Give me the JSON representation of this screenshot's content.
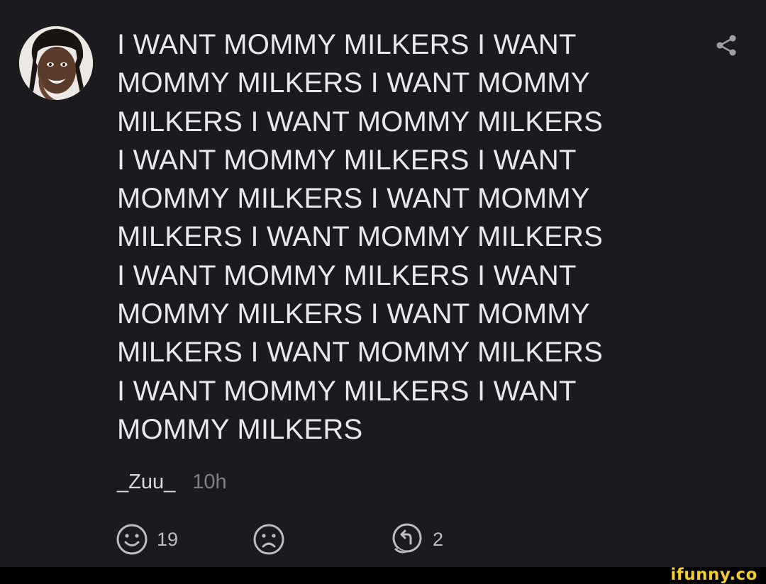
{
  "post": {
    "text": "I WANT MOMMY MILKERS I WANT\nMOMMY MILKERS I WANT MOMMY\nMILKERS I WANT MOMMY MILKERS\nI WANT MOMMY MILKERS I WANT\nMOMMY MILKERS I WANT MOMMY\nMILKERS I WANT MOMMY MILKERS\nI WANT MOMMY MILKERS I WANT\nMOMMY MILKERS I WANT MOMMY\nMILKERS I WANT MOMMY MILKERS\nI WANT MOMMY MILKERS I WANT\nMOMMY MILKERS",
    "username": "_Zuu_",
    "time": "10h"
  },
  "actions": {
    "smile_count": "19",
    "reply_count": "2"
  },
  "icons": {
    "avatar": "avatar",
    "share": "share-icon",
    "smile": "smile-icon",
    "frown": "frown-icon",
    "reply": "reply-icon"
  },
  "watermark": "ifunny.co",
  "colors": {
    "background": "#1b1b1f",
    "text": "#e9e9eb",
    "muted": "#7f7f85",
    "watermark": "#f3cb2b"
  }
}
